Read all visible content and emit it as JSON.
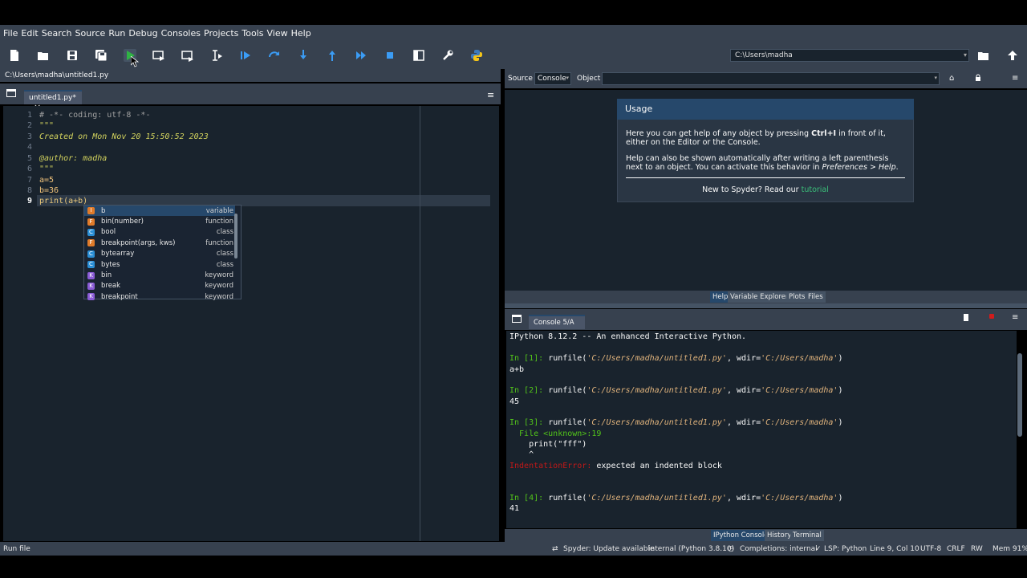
{
  "menu": [
    "File",
    "Edit",
    "Search",
    "Source",
    "Run",
    "Debug",
    "Consoles",
    "Projects",
    "Tools",
    "View",
    "Help"
  ],
  "toolbar": {
    "working_dir": "C:\\Users\\madha",
    "icons": [
      "new-file-icon",
      "open-file-icon",
      "save-icon",
      "save-all-icon",
      "run-file-icon",
      "run-cell-icon",
      "run-cell-advance-icon",
      "run-selection-icon",
      "debug-icon",
      "step-over-icon",
      "step-into-icon",
      "step-return-icon",
      "continue-icon",
      "stop-debug-icon",
      "maximize-pane-icon",
      "preferences-icon",
      "python-path-icon",
      "browse-dir-icon",
      "parent-dir-icon"
    ]
  },
  "editor": {
    "file_path": "C:\\Users\\madha\\untitled1.py",
    "tab_label": "untitled1.py*",
    "line_numbers": [
      "1",
      "2",
      "3",
      "4",
      "5",
      "6",
      "7",
      "8",
      "9"
    ],
    "lines": [
      "# -*- coding: utf-8 -*-",
      "\"\"\"",
      "Created on Mon Nov 20 15:50:52 2023",
      "",
      "@author: madha",
      "\"\"\"",
      "a=5",
      "b=36",
      "print(a+b)"
    ]
  },
  "completion": [
    {
      "badge": "I",
      "name": "b",
      "kind": "variable",
      "color": "#e07b2a"
    },
    {
      "badge": "F",
      "name": "bin(number)",
      "kind": "function",
      "color": "#e07b2a"
    },
    {
      "badge": "C",
      "name": "bool",
      "kind": "class",
      "color": "#2b8fd6"
    },
    {
      "badge": "F",
      "name": "breakpoint(args, kws)",
      "kind": "function",
      "color": "#e07b2a"
    },
    {
      "badge": "C",
      "name": "bytearray",
      "kind": "class",
      "color": "#2b8fd6"
    },
    {
      "badge": "C",
      "name": "bytes",
      "kind": "class",
      "color": "#2b8fd6"
    },
    {
      "badge": "K",
      "name": "bin",
      "kind": "keyword",
      "color": "#8a5bd6"
    },
    {
      "badge": "K",
      "name": "break",
      "kind": "keyword",
      "color": "#8a5bd6"
    },
    {
      "badge": "K",
      "name": "breakpoint",
      "kind": "keyword",
      "color": "#8a5bd6"
    }
  ],
  "help": {
    "source_label": "Source",
    "source_value": "Console",
    "object_label": "Object",
    "usage_title": "Usage",
    "para1_a": "Here you can get help of any object by pressing ",
    "para1_key": "Ctrl+I",
    "para1_b": " in front of it, either on the Editor or the Console.",
    "para2_a": "Help can also be shown automatically after writing a left parenthesis next to an object. You can activate this behavior in ",
    "para2_em": "Preferences > Help",
    "para2_b": ".",
    "footer_text": "New to Spyder? Read our ",
    "footer_link": "tutorial",
    "tabs": [
      "Help",
      "Variable Explorer",
      "Plots",
      "Files"
    ]
  },
  "console": {
    "tab_label": "Console 5/A",
    "banner": "IPython 8.12.2 -- An enhanced Interactive Python.",
    "run_prefix": "runfile(",
    "run_path": "'C:/Users/madha/untitled1.py'",
    "run_mid": ", wdir=",
    "run_wdir": "'C:/Users/madha'",
    "run_suffix": ")",
    "prompts": [
      "In [1]:",
      "In [2]:",
      "In [3]:",
      "In [4]:"
    ],
    "out1": "a+b",
    "out2": "45",
    "err_file": "  File <unknown>:19",
    "err_code": "    print(\"fff\")",
    "err_caret": "    ^",
    "err_name": "IndentationError:",
    "err_msg": " expected an indented block",
    "out4": "41",
    "tabs": [
      "IPython Console",
      "History",
      "Terminal"
    ]
  },
  "status": {
    "left": "Run file",
    "update": "Spyder: Update available",
    "interpreter": "internal (Python 3.8.10)",
    "completions": "Completions: internal",
    "lsp": "LSP: Python",
    "position": "Line 9, Col 10",
    "encoding": "UTF-8",
    "eol": "CRLF",
    "rw": "RW",
    "mem": "Mem 91%"
  }
}
